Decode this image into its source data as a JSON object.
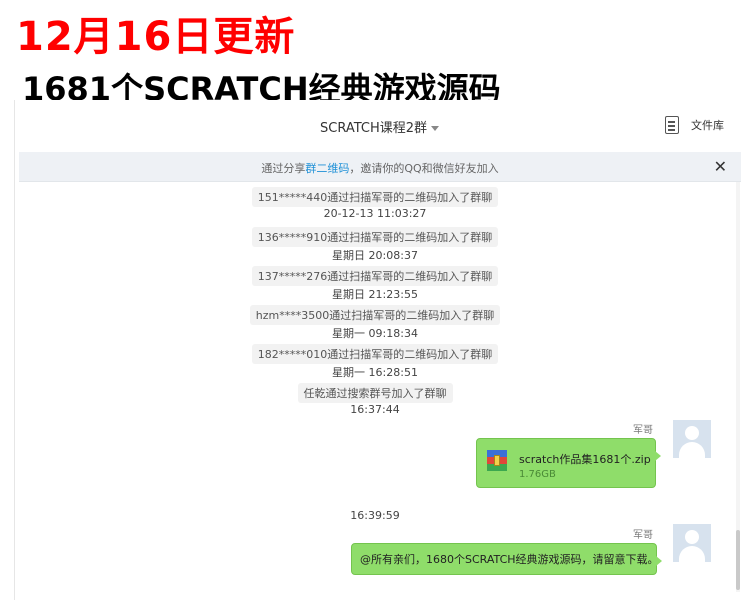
{
  "banner": {
    "title": "12月16日更新",
    "subtitle": "1681个SCRATCH经典游戏源码"
  },
  "header": {
    "title": "SCRATCH课程2群",
    "file_library": "文件库"
  },
  "invite": {
    "prefix": "通过分享",
    "link": "群二维码",
    "suffix": "，邀请你的QQ和微信好友加入"
  },
  "system_messages": [
    {
      "text": "151*****440通过扫描军哥的二维码加入了群聊",
      "time": "20-12-13  11:03:27"
    },
    {
      "text": "136*****910通过扫描军哥的二维码加入了群聊",
      "time": "星期日  20:08:37"
    },
    {
      "text": "137*****276通过扫描军哥的二维码加入了群聊",
      "time": "星期日  21:23:55"
    },
    {
      "text": "hzm****3500通过扫描军哥的二维码加入了群聊",
      "time": "星期一  09:18:34"
    },
    {
      "text": "182*****010通过扫描军哥的二维码加入了群聊",
      "time": "星期一  16:28:51"
    },
    {
      "text": "任乾通过搜索群号加入了群聊",
      "time": "16:37:44"
    }
  ],
  "messages": [
    {
      "sender": "军哥",
      "file_name": "scratch作品集1681个.zip",
      "file_size": "1.76GB"
    },
    {
      "time": "16:39:59"
    },
    {
      "sender": "军哥",
      "text": "@所有亲们，1680个SCRATCH经典游戏源码，请留意下载。"
    }
  ],
  "colors": {
    "banner_title": "#ff0000",
    "bubble": "#8fdd6a",
    "link": "#1e90d6"
  }
}
